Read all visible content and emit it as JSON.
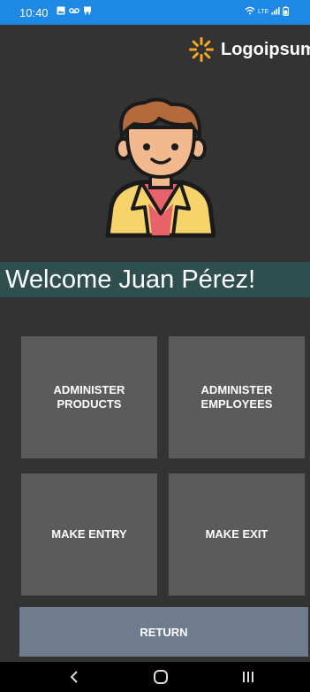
{
  "status_bar": {
    "time": "10:40",
    "left_icons": [
      "image-icon",
      "voicemail-icon",
      "notification-icon"
    ],
    "right_icons": [
      "wifi-icon",
      "volte-icon",
      "signal-icon",
      "battery-icon"
    ]
  },
  "logo": {
    "name": "Logoipsum",
    "accent_color": "#F5A623"
  },
  "welcome": {
    "text": "Welcome Juan Pérez!"
  },
  "actions": {
    "administer_products": {
      "line1": "ADMINISTER",
      "line2": "PRODUCTS"
    },
    "administer_employees": {
      "line1": "ADMINISTER",
      "line2": "EMPLOYEES"
    },
    "make_entry": "MAKE ENTRY",
    "make_exit": "MAKE EXIT",
    "return": "RETURN"
  },
  "nav_bar": {
    "icons": [
      "back-icon",
      "home-icon",
      "recents-icon"
    ]
  },
  "colors": {
    "status_bar": "#1E88E5",
    "background": "#333333",
    "banner": "#2F4F4F",
    "tile": "#5B5B5B",
    "return_button": "#6E7C8E"
  }
}
